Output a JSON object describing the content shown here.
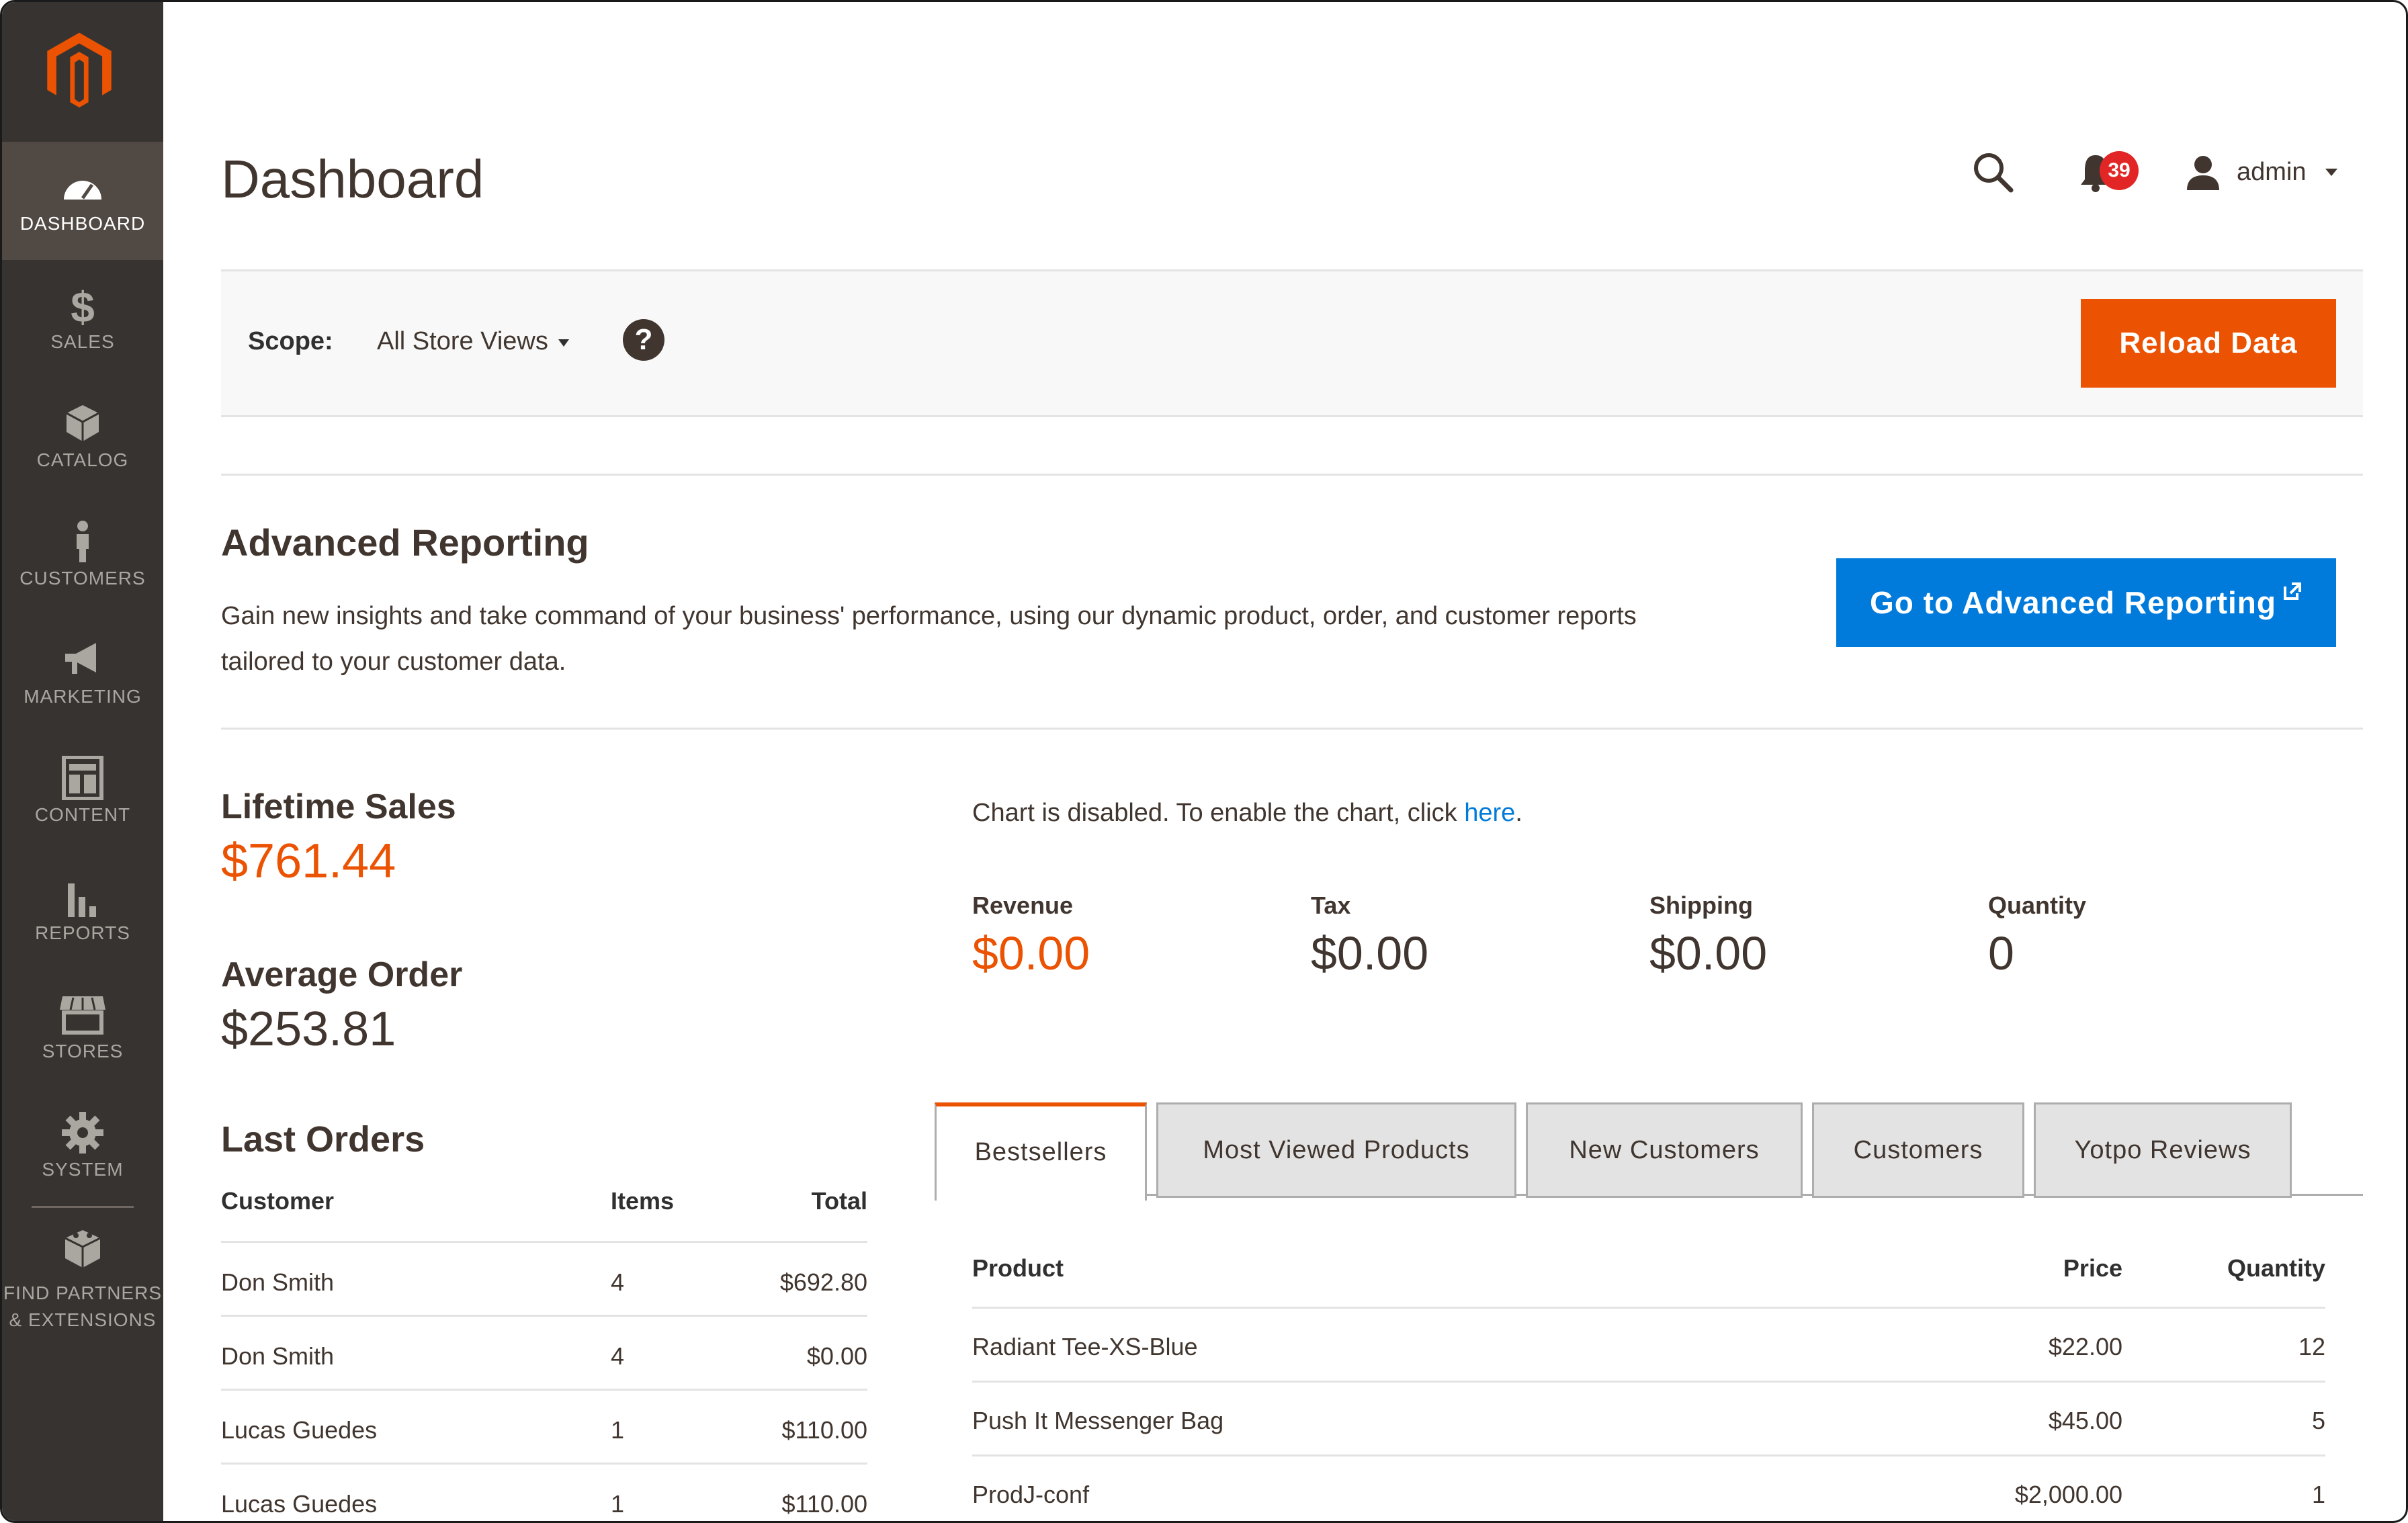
{
  "colors": {
    "sidebar_bg": "#373330",
    "accent_orange": "#eb5202",
    "accent_blue": "#007bdb"
  },
  "sidebar": {
    "items": [
      {
        "label": "DASHBOARD",
        "icon": "dashboard-icon",
        "active": true
      },
      {
        "label": "SALES",
        "icon": "dollar-icon"
      },
      {
        "label": "CATALOG",
        "icon": "box-icon"
      },
      {
        "label": "CUSTOMERS",
        "icon": "person-icon"
      },
      {
        "label": "MARKETING",
        "icon": "megaphone-icon"
      },
      {
        "label": "CONTENT",
        "icon": "layout-icon"
      },
      {
        "label": "REPORTS",
        "icon": "bar-chart-icon"
      },
      {
        "label": "STORES",
        "icon": "store-icon"
      },
      {
        "label": "SYSTEM",
        "icon": "gear-icon"
      }
    ],
    "partners_line1": "FIND PARTNERS",
    "partners_line2": "& EXTENSIONS"
  },
  "header": {
    "title": "Dashboard",
    "notification_count": "39",
    "user": "admin"
  },
  "scope": {
    "label": "Scope:",
    "value": "All Store Views",
    "help": "?",
    "reload_label": "Reload Data"
  },
  "advanced_reporting": {
    "title": "Advanced Reporting",
    "description": "Gain new insights and take command of your business' performance, using our dynamic product, order, and customer reports tailored to your customer data.",
    "button_label": "Go to Advanced Reporting"
  },
  "lifetime_sales": {
    "label": "Lifetime Sales",
    "value": "$761.44"
  },
  "average_order": {
    "label": "Average Order",
    "value": "$253.81"
  },
  "chart": {
    "message": "Chart is disabled. To enable the chart, click ",
    "link": "here",
    "suffix": "."
  },
  "totals": [
    {
      "label": "Revenue",
      "value": "$0.00"
    },
    {
      "label": "Tax",
      "value": "$0.00"
    },
    {
      "label": "Shipping",
      "value": "$0.00"
    },
    {
      "label": "Quantity",
      "value": "0"
    }
  ],
  "last_orders": {
    "title": "Last Orders",
    "columns": [
      "Customer",
      "Items",
      "Total"
    ],
    "rows": [
      {
        "customer": "Don Smith",
        "items": "4",
        "total": "$692.80"
      },
      {
        "customer": "Don Smith",
        "items": "4",
        "total": "$0.00"
      },
      {
        "customer": "Lucas Guedes",
        "items": "1",
        "total": "$110.00"
      },
      {
        "customer": "Lucas Guedes",
        "items": "1",
        "total": "$110.00"
      }
    ]
  },
  "tabs": [
    "Bestsellers",
    "Most Viewed Products",
    "New Customers",
    "Customers",
    "Yotpo Reviews"
  ],
  "bestsellers": {
    "columns": [
      "Product",
      "Price",
      "Quantity"
    ],
    "rows": [
      {
        "product": "Radiant Tee-XS-Blue",
        "price": "$22.00",
        "quantity": "12"
      },
      {
        "product": "Push It Messenger Bag",
        "price": "$45.00",
        "quantity": "5"
      },
      {
        "product": "ProdJ-conf",
        "price": "$2,000.00",
        "quantity": "1"
      }
    ]
  }
}
